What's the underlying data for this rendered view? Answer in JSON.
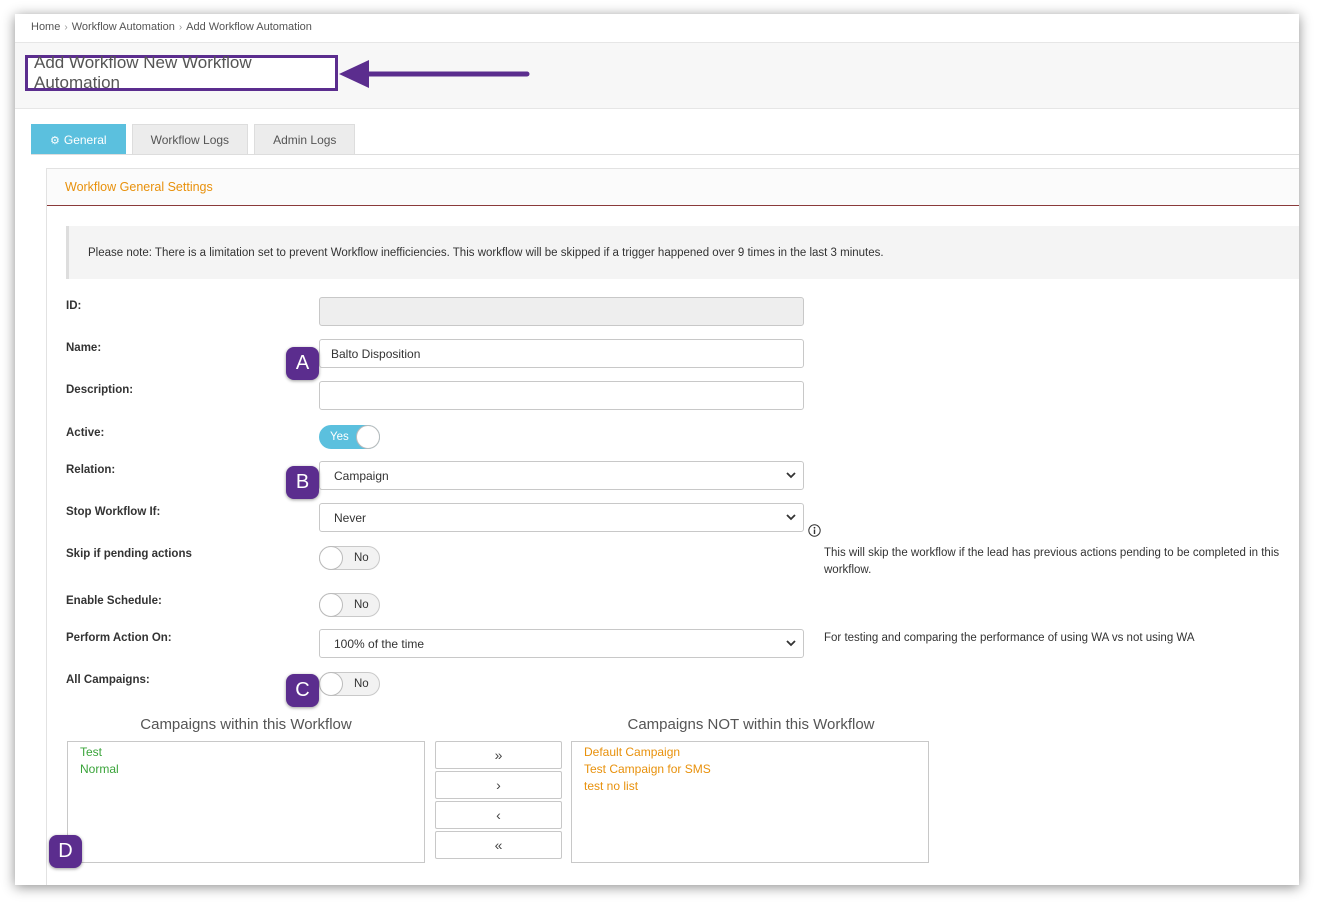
{
  "breadcrumb": [
    "Home",
    "Workflow Automation",
    "Add Workflow Automation"
  ],
  "page_title": "Add Workflow New Workflow Automation",
  "tabs": [
    {
      "label": "General",
      "icon": "gears-icon",
      "active": true
    },
    {
      "label": "Workflow Logs",
      "active": false
    },
    {
      "label": "Admin Logs",
      "active": false
    }
  ],
  "panel": {
    "title": "Workflow General Settings",
    "note": "Please note: There is a limitation set to prevent Workflow inefficiencies. This workflow will be skipped if a trigger happened over 9 times in the last 3 minutes."
  },
  "form": {
    "id": {
      "label": "ID:",
      "value": ""
    },
    "name": {
      "label": "Name:",
      "value": "Balto Disposition"
    },
    "description": {
      "label": "Description:",
      "value": ""
    },
    "active": {
      "label": "Active:",
      "state": "Yes"
    },
    "relation": {
      "label": "Relation:",
      "value": "Campaign"
    },
    "stop_if": {
      "label": "Stop Workflow If:",
      "value": "Never"
    },
    "skip_pending": {
      "label": "Skip if pending actions",
      "state": "No",
      "help": "This will skip the workflow if the lead has previous actions pending to be completed in this workflow."
    },
    "enable_schedule": {
      "label": "Enable Schedule:",
      "state": "No"
    },
    "perform_on": {
      "label": "Perform Action On:",
      "value": "100% of the time",
      "help": "For testing and comparing the performance of using WA vs not using WA"
    },
    "all_campaigns": {
      "label": "All Campaigns:",
      "state": "No"
    }
  },
  "lists": {
    "within_title": "Campaigns within this Workflow",
    "within": [
      "Test",
      "Normal"
    ],
    "not_within_title": "Campaigns NOT within this Workflow",
    "not_within": [
      "Default Campaign",
      "Test Campaign for SMS",
      "test no list"
    ],
    "buttons": [
      "»",
      "›",
      "‹",
      "«"
    ]
  },
  "annotations": {
    "a": "A",
    "b": "B",
    "c": "C",
    "d": "D"
  },
  "colors": {
    "accent": "#5bc0de",
    "annotation": "#5b2d8e",
    "panel_title": "#e8910c",
    "included": "#3aa43a",
    "excluded": "#e8910c"
  }
}
